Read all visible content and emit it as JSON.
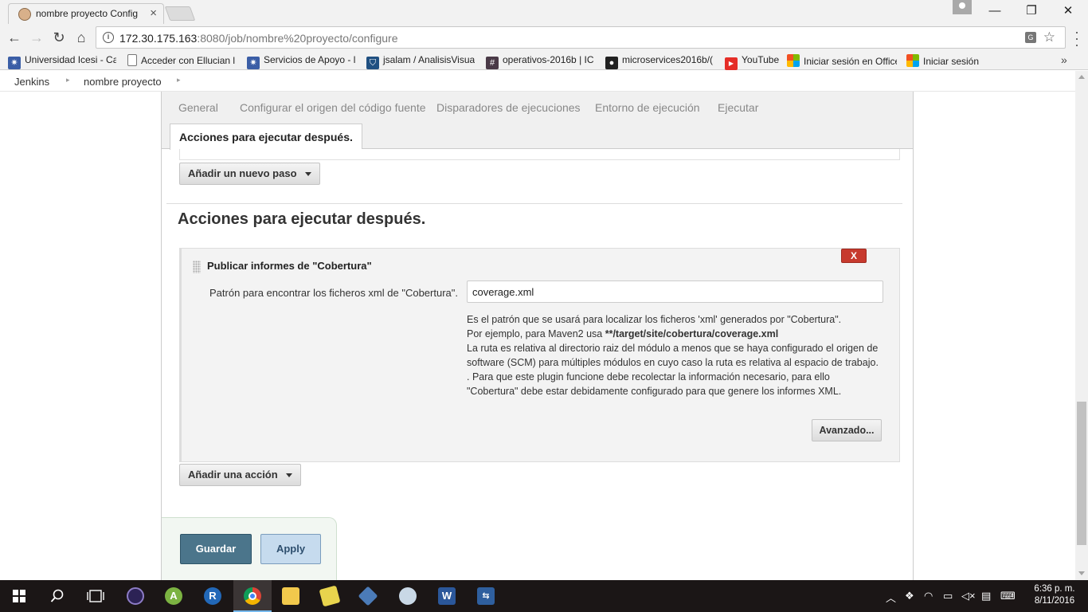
{
  "browser": {
    "tab_title": "nombre proyecto Config",
    "tab_close": "×",
    "url_host": "172.30.175.163",
    "url_rest": ":8080/job/nombre%20proyecto/configure",
    "translate_icon": "G",
    "star_icon": "☆",
    "window_controls": {
      "minimize": "—",
      "restore": "❐",
      "close": "✕"
    },
    "nav": {
      "back": "←",
      "forward": "→",
      "reload": "↻",
      "home": "⌂"
    }
  },
  "bookmarks": [
    {
      "label": "Universidad Icesi - Ca",
      "icon": "gear-icon",
      "color": "#3b5ea6",
      "glyph": "✷"
    },
    {
      "label": "Acceder con Ellucian l",
      "icon": "page-icon",
      "color": "#ffffff",
      "glyph": ""
    },
    {
      "label": "Servicios de Apoyo - l",
      "icon": "gear-icon",
      "color": "#3b5ea6",
      "glyph": "✷"
    },
    {
      "label": "jsalam / AnalisisVisual",
      "icon": "bitbucket-icon",
      "color": "#205081",
      "glyph": "⛉"
    },
    {
      "label": "operativos-2016b | IC",
      "icon": "slack-icon",
      "color": "#4a3a47",
      "glyph": "#"
    },
    {
      "label": "microservices2016b/(",
      "icon": "github-icon",
      "color": "#222222",
      "glyph": "●"
    },
    {
      "label": "YouTube",
      "icon": "youtube-icon",
      "color": "#e52d27",
      "glyph": "▶"
    },
    {
      "label": "Iniciar sesión en Office",
      "icon": "microsoft-icon",
      "color": "#f25022",
      "glyph": ""
    },
    {
      "label": "Iniciar sesión",
      "icon": "microsoft-icon",
      "color": "#f25022",
      "glyph": ""
    }
  ],
  "bookmarks_more": "»",
  "breadcrumb": {
    "root": "Jenkins",
    "job": "nombre proyecto",
    "sep": "▸"
  },
  "config_tabs": [
    "General",
    "Configurar el origen del código fuente",
    "Disparadores de ejecuciones",
    "Entorno de ejecución",
    "Ejecutar"
  ],
  "active_tab": "Acciones para ejecutar después.",
  "add_step_button": "Añadir un nuevo paso",
  "section": {
    "title": "Acciones para ejecutar después.",
    "plugin": {
      "title": "Publicar informes de \"Cobertura\"",
      "delete_label": "X",
      "field_label": "Patrón para encontrar los ficheros xml de \"Cobertura\".",
      "field_value": "coverage.xml",
      "help": {
        "line1": "Es el patrón que se usará para localizar los ficheros 'xml' generados por \"Cobertura\".",
        "line2_prefix": "Por ejemplo, para Maven2 usa ",
        "line2_bold": "**/target/site/cobertura/coverage.xml",
        "line3": "La ruta es relativa al directorio raiz del módulo a menos que se haya configurado el origen de software (SCM) para múltiples módulos en cuyo caso la ruta es relativa al espacio de trabajo.",
        "line4": ". Para que este plugin funcione debe recolectar la información necesario, para ello \"Cobertura\" debe estar debidamente configurado para que genere los informes XML."
      },
      "advanced_button": "Avanzado..."
    }
  },
  "add_action_button": "Añadir una acción",
  "save_button": "Guardar",
  "apply_button": "Apply",
  "taskbar": {
    "clock_time": "6:36 p. m.",
    "clock_date": "8/11/2016"
  }
}
